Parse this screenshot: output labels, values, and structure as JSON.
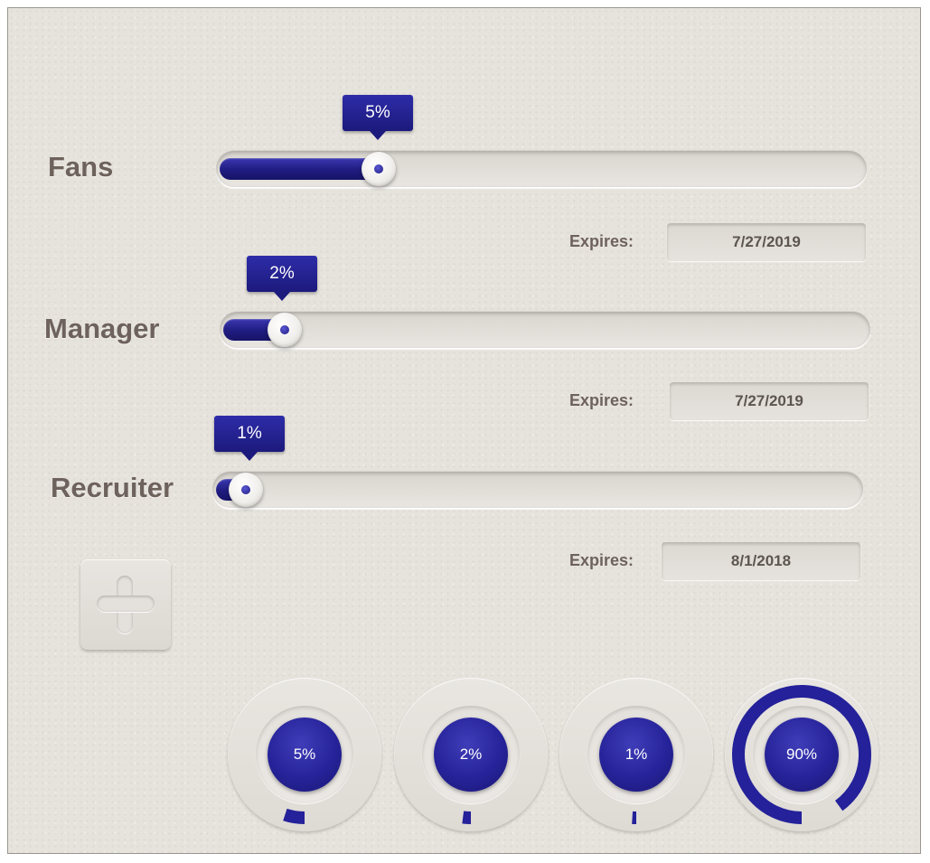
{
  "colors": {
    "accent": "#24219a",
    "accent_dark": "#171468",
    "label_text": "#6e625c",
    "background": "#e6e2dc"
  },
  "sliders": [
    {
      "label": "Fans",
      "value_label": "5%",
      "value": 5,
      "expires_label": "Expires:",
      "expires_value": "7/27/2019"
    },
    {
      "label": "Manager",
      "value_label": "2%",
      "value": 2,
      "expires_label": "Expires:",
      "expires_value": "7/27/2019"
    },
    {
      "label": "Recruiter",
      "value_label": "1%",
      "value": 1,
      "expires_label": "Expires:",
      "expires_value": "8/1/2018"
    }
  ],
  "add_button": {
    "icon": "plus-icon"
  },
  "gauges": [
    {
      "label": "5%",
      "fraction": 0.05
    },
    {
      "label": "2%",
      "fraction": 0.02
    },
    {
      "label": "1%",
      "fraction": 0.01
    },
    {
      "label": "90%",
      "fraction": 0.9
    }
  ]
}
